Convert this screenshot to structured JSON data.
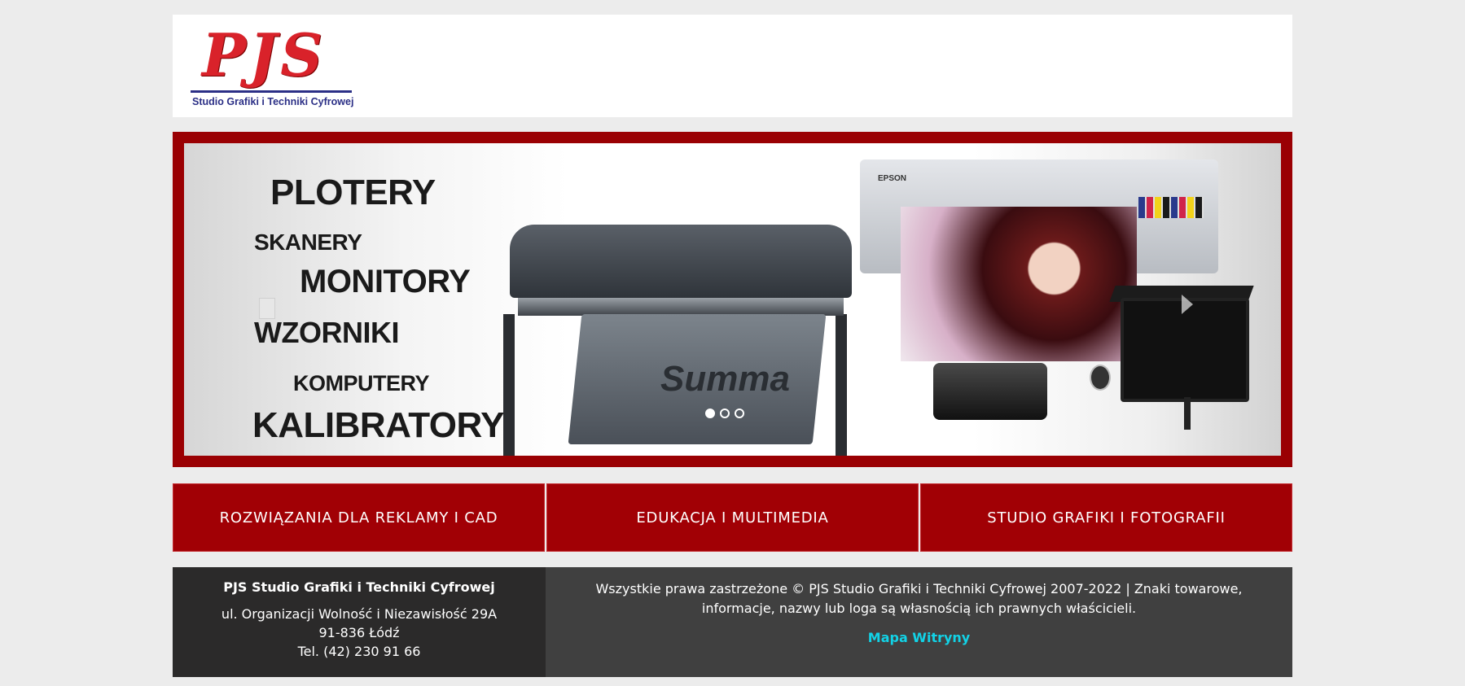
{
  "header": {
    "logo_mark": "PJS",
    "logo_tagline": "Studio Grafiki i Techniki Cyfrowej"
  },
  "slider": {
    "words": [
      "PLOTERY",
      "SKANERY",
      "MONITORY",
      "WZORNIKI",
      "KOMPUTERY",
      "KALIBRATORY"
    ],
    "cutter_brand": "Summa",
    "printer_brand": "EPSON",
    "active_slide": 1,
    "slide_count": 3
  },
  "tiles": [
    {
      "label": "ROZWIĄZANIA DLA REKLAMY I CAD"
    },
    {
      "label": "EDUKACJA I MULTIMEDIA"
    },
    {
      "label": "STUDIO GRAFIKI I FOTOGRAFII"
    }
  ],
  "footer": {
    "company": "PJS Studio Grafiki i Techniki Cyfrowej",
    "street": "ul. Organizacji Wolność i Niezawisłość 29A",
    "city": "91-836 Łódź",
    "phone": "Tel. (42) 230 91 66",
    "copyright": "Wszystkie prawa zastrzeżone © PJS Studio Grafiki i Techniki Cyfrowej 2007-2022 | Znaki towarowe, informacje, nazwy lub loga są własnością ich prawnych właścicieli.",
    "sitemap": "Mapa Witryny"
  },
  "colors": {
    "brand_red": "#a10005",
    "logo_red": "#d9222a",
    "logo_blue": "#2b2f86",
    "link_cyan": "#12d2e6"
  }
}
